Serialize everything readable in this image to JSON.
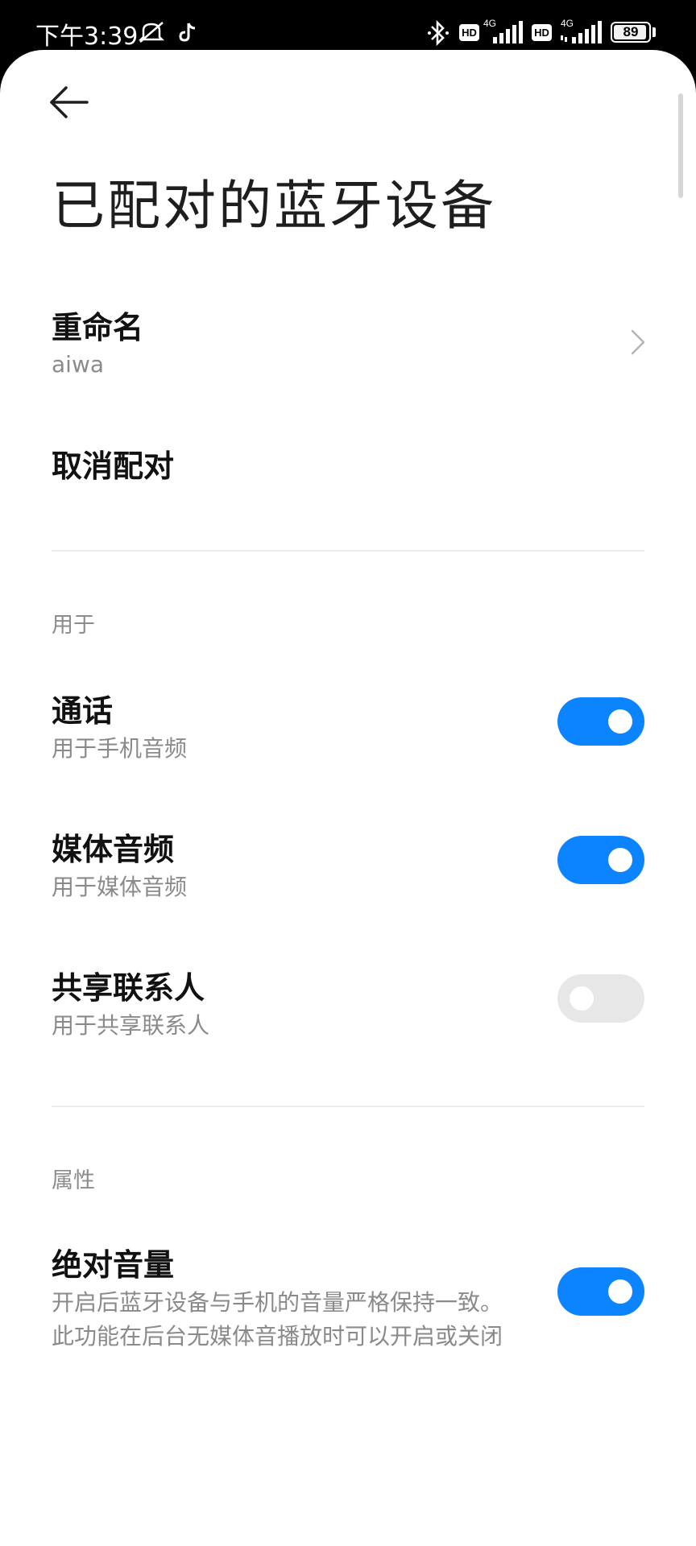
{
  "status_bar": {
    "time": "下午3:39",
    "battery_level": "89",
    "network_1": "4G",
    "network_2": "4G",
    "hd_label": "HD",
    "icons": [
      "mute-icon",
      "tiktok-icon",
      "bluetooth-icon",
      "signal-icon",
      "signal-icon",
      "battery-icon"
    ]
  },
  "header": {
    "back_icon": "arrow-left-icon",
    "title": "已配对的蓝牙设备"
  },
  "rename": {
    "title": "重命名",
    "value": "aiwa"
  },
  "unpair": {
    "title": "取消配对"
  },
  "usage_section": {
    "label": "用于",
    "items": [
      {
        "title": "通话",
        "subtitle": "用于手机音频",
        "enabled": true
      },
      {
        "title": "媒体音频",
        "subtitle": "用于媒体音频",
        "enabled": true
      },
      {
        "title": "共享联系人",
        "subtitle": "用于共享联系人",
        "enabled": false
      }
    ]
  },
  "properties_section": {
    "label": "属性",
    "absolute_volume": {
      "title": "绝对音量",
      "subtitle_line1": "开启后蓝牙设备与手机的音量严格保持一致。",
      "subtitle_line2": "此功能在后台无媒体音播放时可以开启或关闭",
      "enabled": true
    }
  },
  "colors": {
    "accent": "#0d84ff",
    "toggle_off": "#e7e7e7"
  }
}
